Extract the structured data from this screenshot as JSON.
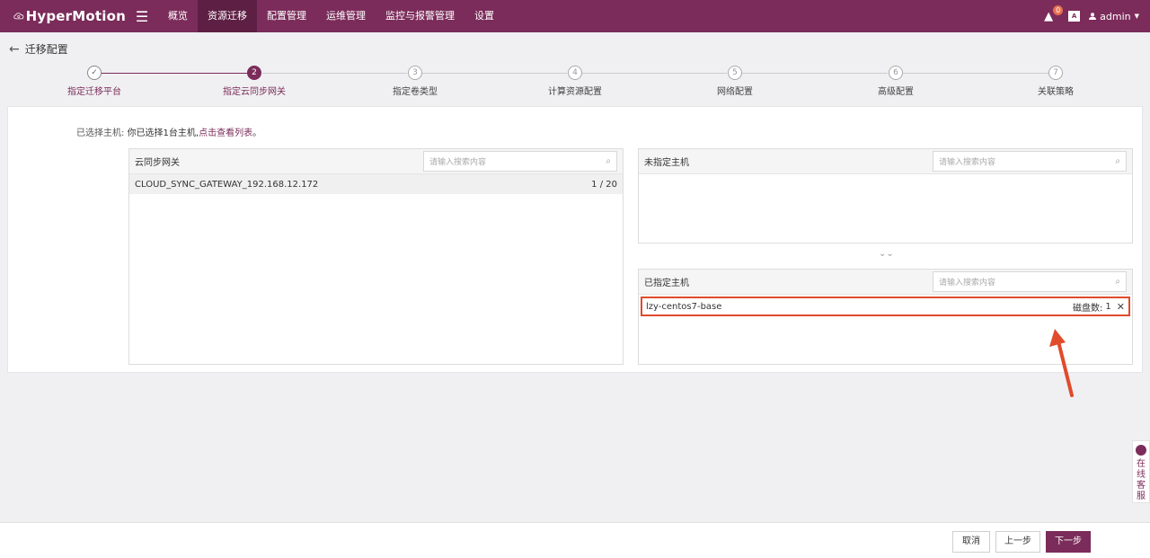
{
  "app": {
    "name": "HyperMotion",
    "nav": [
      "概览",
      "资源迁移",
      "配置管理",
      "运维管理",
      "监控与报警管理",
      "设置"
    ],
    "active_nav": "资源迁移",
    "alert_count": "0",
    "lang_icon": "A",
    "user": "admin",
    "colors": {
      "brand": "#7b2c5a",
      "highlight": "#e04b2c"
    }
  },
  "page": {
    "title": "迁移配置"
  },
  "steps": [
    {
      "label": "指定迁移平台",
      "num": "✓",
      "state": "done"
    },
    {
      "label": "指定云同步网关",
      "num": "2",
      "state": "current"
    },
    {
      "label": "指定卷类型",
      "num": "3",
      "state": "todo"
    },
    {
      "label": "计算资源配置",
      "num": "4",
      "state": "todo"
    },
    {
      "label": "网络配置",
      "num": "5",
      "state": "todo"
    },
    {
      "label": "高级配置",
      "num": "6",
      "state": "todo"
    },
    {
      "label": "关联策略",
      "num": "7",
      "state": "todo"
    }
  ],
  "selection": {
    "label": "已选择主机:",
    "text": "你已选择1台主机,",
    "link": "点击查看列表",
    "end": "。"
  },
  "gateway_panel": {
    "title": "云同步网关",
    "search_placeholder": "请输入搜索内容",
    "row_name": "CLOUD_SYNC_GATEWAY_192.168.12.172",
    "row_count": "1 / 20"
  },
  "unassigned_panel": {
    "title": "未指定主机",
    "search_placeholder": "请输入搜索内容"
  },
  "assigned_panel": {
    "title": "已指定主机",
    "search_placeholder": "请输入搜索内容",
    "host_name": "lzy-centos7-base",
    "disk_label": "磁盘数:",
    "disk_count": "1"
  },
  "help": {
    "text": "在线客服"
  },
  "footer": {
    "cancel": "取消",
    "prev": "上一步",
    "next": "下一步"
  }
}
